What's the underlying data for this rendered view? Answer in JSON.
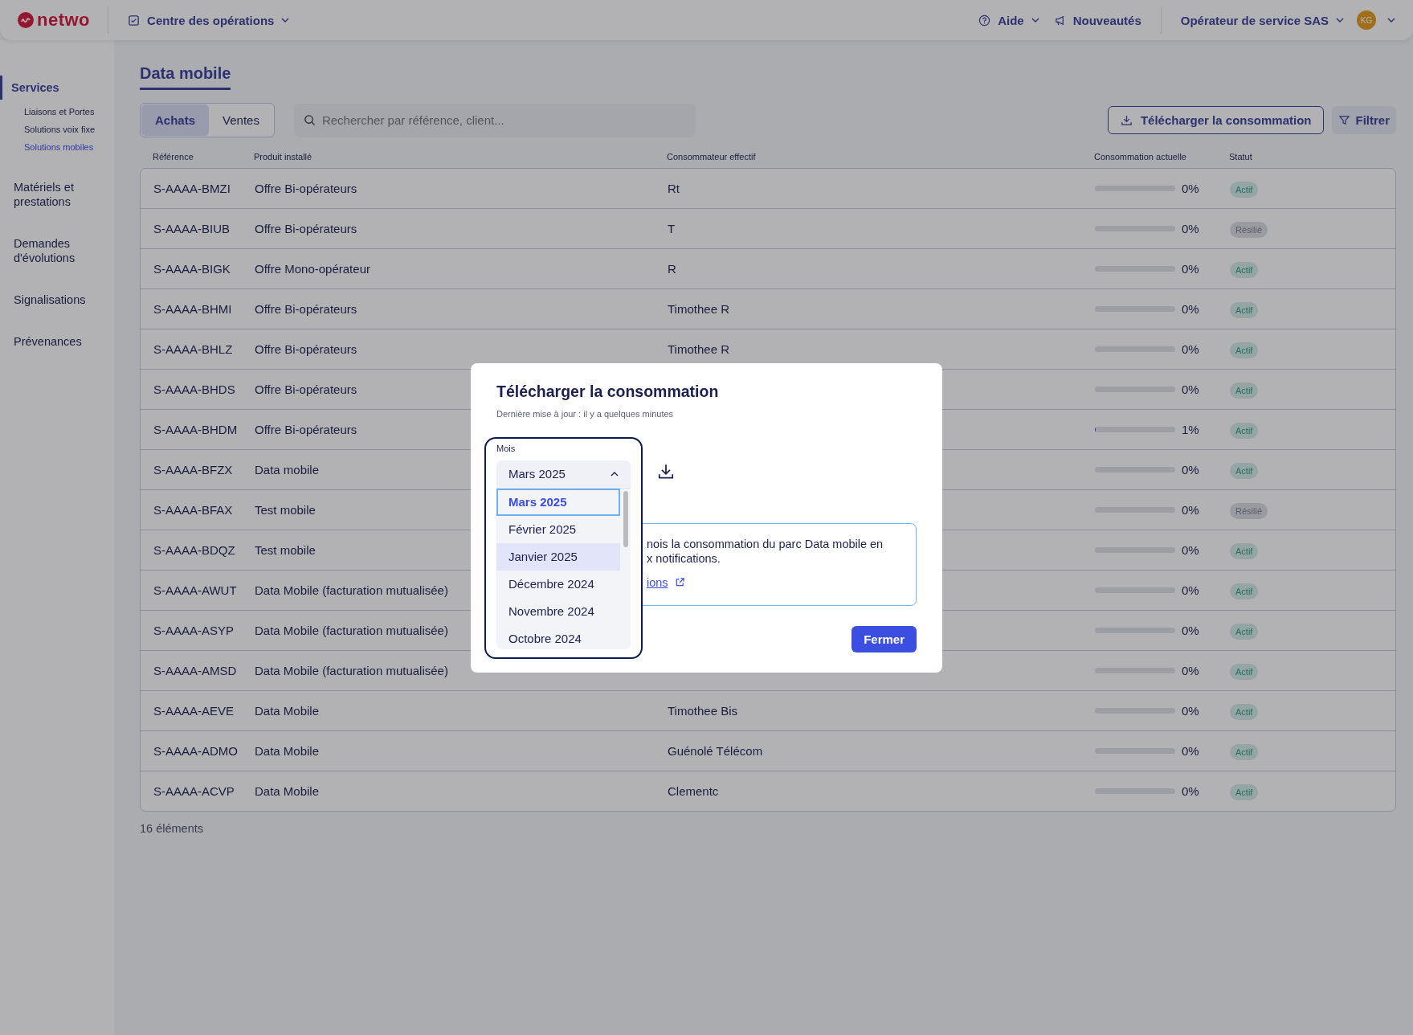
{
  "header": {
    "logo": "netwo",
    "nav": "Centre des opérations",
    "help": "Aide",
    "news": "Nouveautés",
    "account": "Opérateur de service SAS",
    "avatar": "KG"
  },
  "sidebar": [
    {
      "label": "Services",
      "selected": true,
      "children": [
        {
          "label": "Liaisons et Portes",
          "selected": false
        },
        {
          "label": "Solutions voix fixe",
          "selected": false
        },
        {
          "label": "Solutions mobiles",
          "selected": true
        }
      ]
    },
    {
      "label": "Matériels et prestations",
      "selected": false
    },
    {
      "label": "Demandes d'évolutions",
      "selected": false
    },
    {
      "label": "Signalisations",
      "selected": false
    },
    {
      "label": "Prévenances",
      "selected": false
    }
  ],
  "page": {
    "title": "Data mobile",
    "segments": [
      {
        "label": "Achats",
        "selected": true
      },
      {
        "label": "Ventes",
        "selected": false
      }
    ],
    "search": {
      "placeholder": "Rechercher par référence, client..."
    },
    "download_button": "Télécharger la consommation",
    "filter_button": "Filtrer",
    "table": {
      "columns": [
        "Référence",
        "Produit installé",
        "Consommateur effectif",
        "Consommation actuelle",
        "Statut"
      ],
      "rows": [
        {
          "ref": "S-AAAA-BMZI",
          "product": "Offre Bi-opérateurs",
          "consumer": "Rt",
          "level": 0,
          "reading": "0%",
          "status": {
            "label": "Actif",
            "kind": "active"
          }
        },
        {
          "ref": "S-AAAA-BIUB",
          "product": "Offre Bi-opérateurs",
          "consumer": "T",
          "level": 0,
          "reading": "0%",
          "status": {
            "label": "Résilié",
            "kind": "terminated"
          }
        },
        {
          "ref": "S-AAAA-BIGK",
          "product": "Offre Mono-opérateur",
          "consumer": "R",
          "level": 0,
          "reading": "0%",
          "status": {
            "label": "Actif",
            "kind": "active"
          }
        },
        {
          "ref": "S-AAAA-BHMI",
          "product": "Offre Bi-opérateurs",
          "consumer": "Timothee R",
          "level": 0,
          "reading": "0%",
          "status": {
            "label": "Actif",
            "kind": "active"
          }
        },
        {
          "ref": "S-AAAA-BHLZ",
          "product": "Offre Bi-opérateurs",
          "consumer": "Timothee R",
          "level": 0,
          "reading": "0%",
          "status": {
            "label": "Actif",
            "kind": "active"
          }
        },
        {
          "ref": "S-AAAA-BHDS",
          "product": "Offre Bi-opérateurs",
          "level": 0,
          "reading": "0%",
          "status": {
            "label": "Actif",
            "kind": "active"
          }
        },
        {
          "ref": "S-AAAA-BHDM",
          "product": "Offre Bi-opérateurs",
          "level": 0.01,
          "reading": "1%",
          "status": {
            "label": "Actif",
            "kind": "active"
          }
        },
        {
          "ref": "S-AAAA-BFZX",
          "product": "Data mobile",
          "level": 0,
          "reading": "0%",
          "status": {
            "label": "Actif",
            "kind": "active"
          }
        },
        {
          "ref": "S-AAAA-BFAX",
          "product": "Test mobile",
          "level": 0,
          "reading": "0%",
          "status": {
            "label": "Résilié",
            "kind": "terminated"
          }
        },
        {
          "ref": "S-AAAA-BDQZ",
          "product": "Test mobile",
          "level": 0,
          "reading": "0%",
          "status": {
            "label": "Actif",
            "kind": "active"
          }
        },
        {
          "ref": "S-AAAA-AWUT",
          "product": "Data Mobile (facturation mutualisée)",
          "level": 0,
          "reading": "0%",
          "status": {
            "label": "Actif",
            "kind": "active"
          }
        },
        {
          "ref": "S-AAAA-ASYP",
          "product": "Data Mobile (facturation mutualisée)",
          "level": 0,
          "reading": "0%",
          "status": {
            "label": "Actif",
            "kind": "active"
          }
        },
        {
          "ref": "S-AAAA-AMSD",
          "product": "Data Mobile (facturation mutualisée)",
          "level": 0,
          "reading": "0%",
          "status": {
            "label": "Actif",
            "kind": "active"
          }
        },
        {
          "ref": "S-AAAA-AEVE",
          "product": "Data Mobile",
          "consumer": "Timothee Bis",
          "level": 0,
          "reading": "0%",
          "status": {
            "label": "Actif",
            "kind": "active"
          }
        },
        {
          "ref": "S-AAAA-ADMO",
          "product": "Data Mobile",
          "consumer": "Guénolé Télécom",
          "level": 0,
          "reading": "0%",
          "status": {
            "label": "Actif",
            "kind": "active"
          }
        },
        {
          "ref": "S-AAAA-ACVP",
          "product": "Data Mobile",
          "consumer": "Clementc",
          "level": 0,
          "reading": "0%",
          "status": {
            "label": "Actif",
            "kind": "active"
          }
        }
      ]
    },
    "count": "16 éléments"
  },
  "modal": {
    "title": "Télécharger la consommation",
    "subtitle": "Dernière mise à jour : il y a quelques minutes",
    "month": {
      "label": "Mois",
      "value": "Mars 2025",
      "expanded": true,
      "options": [
        {
          "label": "Mars 2025",
          "selected": true,
          "hovered": false
        },
        {
          "label": "Février 2025",
          "selected": false,
          "hovered": false
        },
        {
          "label": "Janvier 2025",
          "selected": false,
          "hovered": true
        },
        {
          "label": "Décembre 2024",
          "selected": false,
          "hovered": false
        },
        {
          "label": "Novembre 2024",
          "selected": false,
          "hovered": false
        },
        {
          "label": "Octobre 2024",
          "selected": false,
          "hovered": false
        }
      ]
    },
    "info_lines": [
      "nois la consommation du parc Data mobile en",
      "x notifications."
    ],
    "info_link": "ions",
    "close_button": "Fermer"
  }
}
